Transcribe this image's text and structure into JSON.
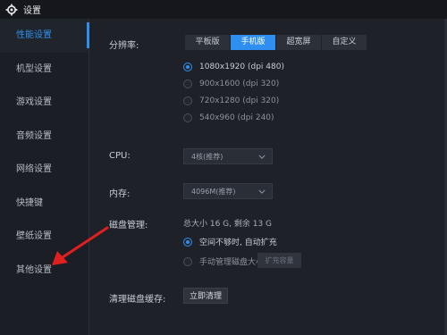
{
  "window": {
    "title": "设置"
  },
  "sidebar": {
    "items": [
      {
        "label": "性能设置"
      },
      {
        "label": "机型设置"
      },
      {
        "label": "游戏设置"
      },
      {
        "label": "音频设置"
      },
      {
        "label": "网络设置"
      },
      {
        "label": "快捷键"
      },
      {
        "label": "壁纸设置"
      },
      {
        "label": "其他设置"
      }
    ]
  },
  "resolution": {
    "label": "分辨率:",
    "tabs": [
      "平板版",
      "手机版",
      "超宽屏",
      "自定义"
    ],
    "options": [
      "1080x1920 (dpi 480)",
      "900x1600 (dpi 320)",
      "720x1280 (dpi 320)",
      "540x960 (dpi 240)"
    ]
  },
  "cpu": {
    "label": "CPU:",
    "value": "4核(推荐)"
  },
  "memory": {
    "label": "内存:",
    "value": "4096M(推荐)"
  },
  "disk": {
    "label": "磁盘管理:",
    "summary": "总大小 16 G, 剩余 13 G",
    "option_auto": "空间不够时, 自动扩充",
    "option_manual": "手动管理磁盘大小",
    "expand_button": "扩充容量"
  },
  "cache": {
    "label": "清理磁盘缓存:",
    "button": "立即清理"
  },
  "colors": {
    "accent": "#2f8ff0",
    "annotation": "#e02020"
  }
}
